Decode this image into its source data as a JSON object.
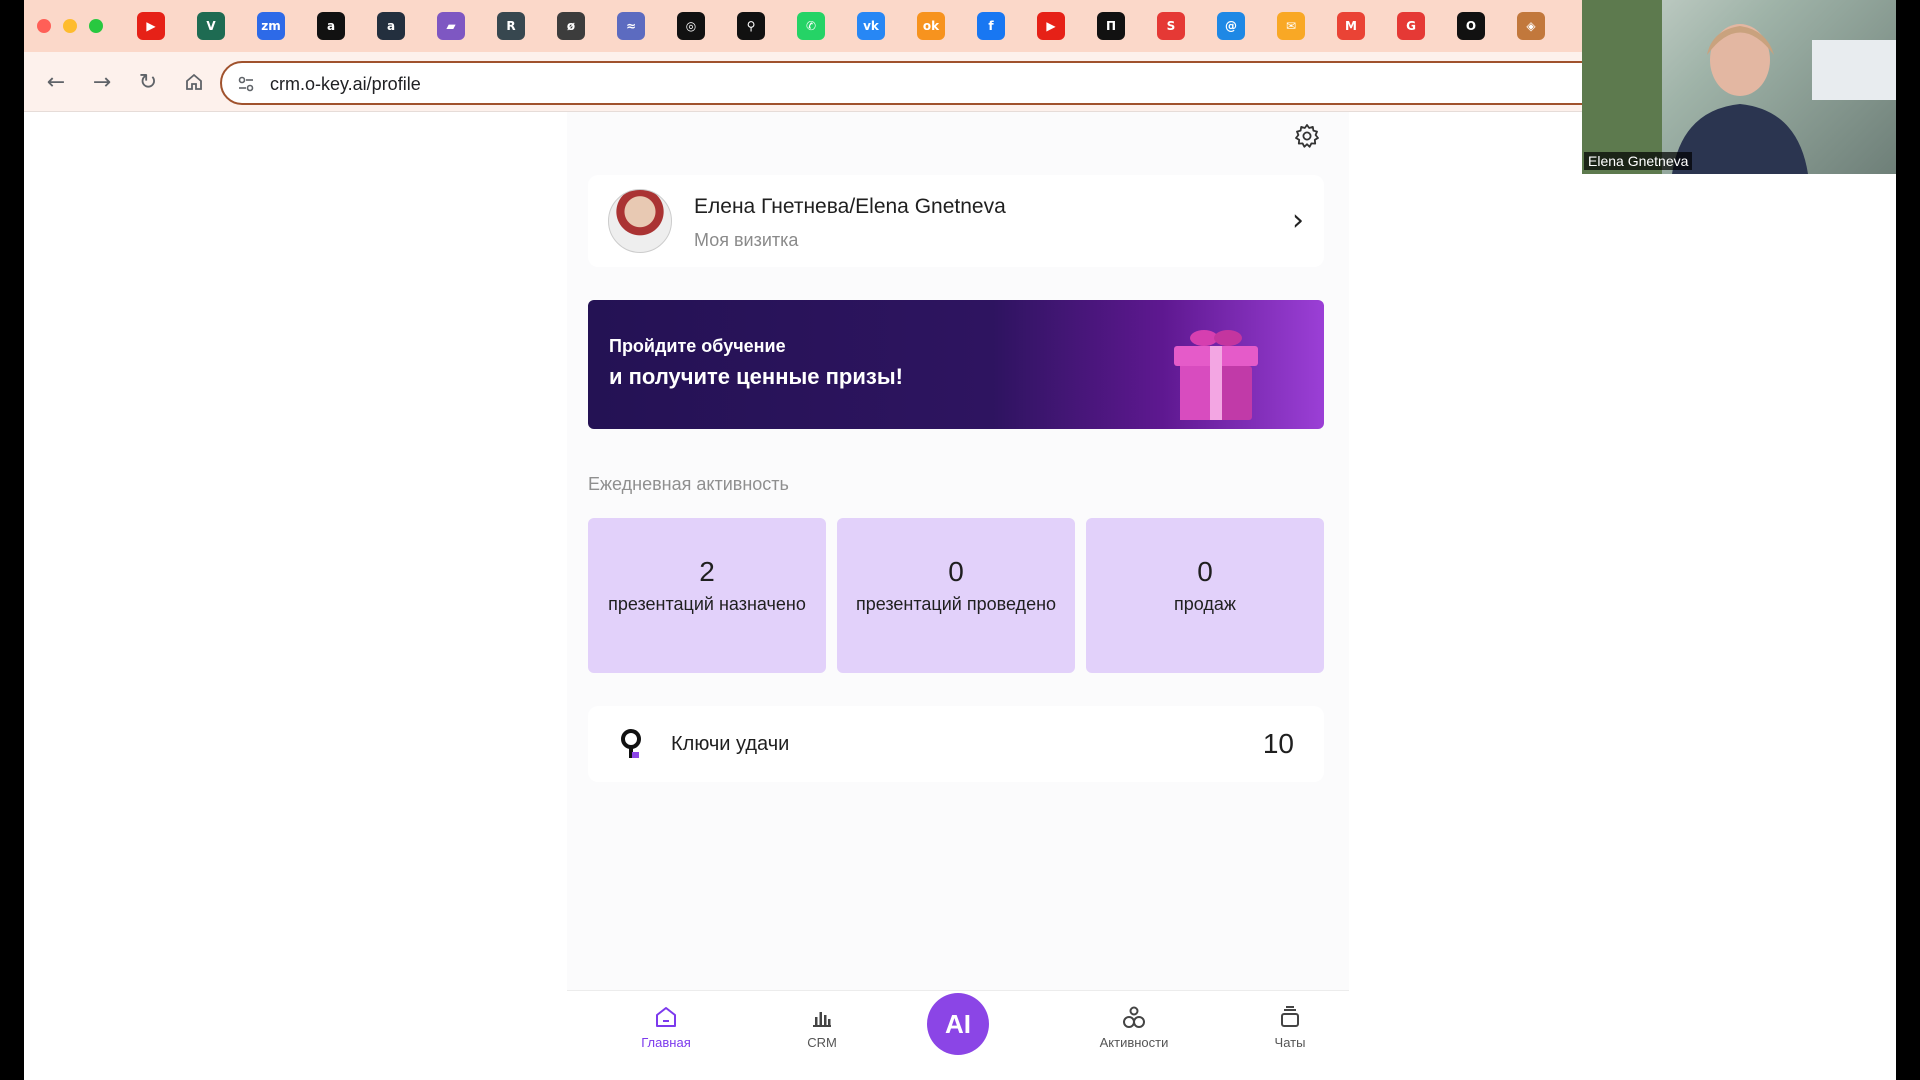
{
  "browser": {
    "url": "crm.o-key.ai/profile",
    "bookmarks": [
      {
        "name": "youtube",
        "glyph": "▶",
        "color": "#e62117"
      },
      {
        "name": "vuetify",
        "glyph": "V",
        "color": "#1e6b52"
      },
      {
        "name": "zoom",
        "glyph": "zm",
        "color": "#2d6ae8"
      },
      {
        "name": "amazon",
        "glyph": "a",
        "color": "#111111"
      },
      {
        "name": "amazon-dark",
        "glyph": "a",
        "color": "#232f3e"
      },
      {
        "name": "bookmark-purple",
        "glyph": "▰",
        "color": "#7e57c2"
      },
      {
        "name": "r-app",
        "glyph": "R",
        "color": "#37474f"
      },
      {
        "name": "slash-app",
        "glyph": "ø",
        "color": "#3c3c3c"
      },
      {
        "name": "bird-app",
        "glyph": "≈",
        "color": "#5c6bc0"
      },
      {
        "name": "openai",
        "glyph": "◎",
        "color": "#111111"
      },
      {
        "name": "okey",
        "glyph": "⚲",
        "color": "#111111"
      },
      {
        "name": "whatsapp",
        "glyph": "✆",
        "color": "#25d366"
      },
      {
        "name": "vk",
        "glyph": "vk",
        "color": "#2787f5"
      },
      {
        "name": "odnoklassniki",
        "glyph": "ok",
        "color": "#f7931e"
      },
      {
        "name": "facebook",
        "glyph": "f",
        "color": "#1877f2"
      },
      {
        "name": "youtube-2",
        "glyph": "▶",
        "color": "#e62117"
      },
      {
        "name": "p-app",
        "glyph": "П",
        "color": "#111111"
      },
      {
        "name": "s-app",
        "glyph": "S",
        "color": "#e53935"
      },
      {
        "name": "mail-app",
        "glyph": "@",
        "color": "#1e88e5"
      },
      {
        "name": "yandex-mail",
        "glyph": "✉",
        "color": "#f9a825"
      },
      {
        "name": "gmail",
        "glyph": "M",
        "color": "#ea4335"
      },
      {
        "name": "g-app",
        "glyph": "G",
        "color": "#e53935"
      },
      {
        "name": "o-app",
        "glyph": "O",
        "color": "#111111"
      },
      {
        "name": "shield-app",
        "glyph": "◈",
        "color": "#c2783c"
      }
    ]
  },
  "video": {
    "participant_name": "Elena Gnetneva"
  },
  "profile": {
    "name": "Елена Гнетнева/Elena Gnetneva",
    "subtitle": "Моя визитка"
  },
  "banner": {
    "line1": "Пройдите обучение",
    "line2": "и получите ценные призы!"
  },
  "activity": {
    "title": "Ежедневная активность",
    "stats": [
      {
        "value": "2",
        "label": "презентаций назначено"
      },
      {
        "value": "0",
        "label": "презентаций проведено"
      },
      {
        "value": "0",
        "label": "продаж"
      }
    ]
  },
  "keys": {
    "label": "Ключи удачи",
    "value": "10"
  },
  "nav": {
    "items": [
      {
        "label": "Главная",
        "icon": "home-icon",
        "active": true
      },
      {
        "label": "CRM",
        "icon": "bar-chart-icon",
        "active": false
      },
      {
        "label": "Активности",
        "icon": "activities-icon",
        "active": false
      },
      {
        "label": "Чаты",
        "icon": "chats-icon",
        "active": false
      }
    ],
    "ai_label": "AI"
  },
  "colors": {
    "accent": "#8b45e6",
    "stat_bg": "#e2d1fa",
    "banner_dark": "#241254"
  }
}
